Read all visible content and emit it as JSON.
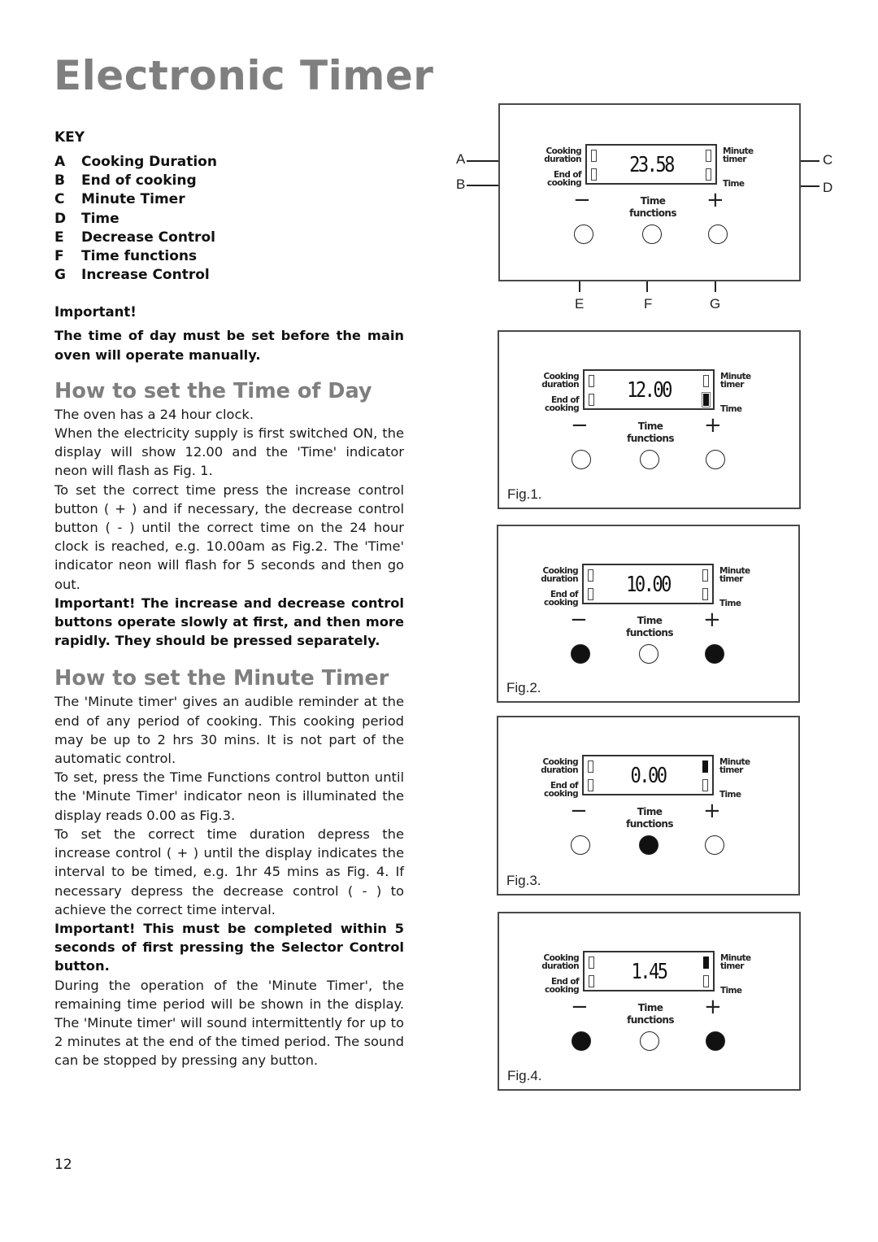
{
  "page": {
    "title": "Electronic Timer",
    "page_number": "12"
  },
  "key": {
    "heading": "KEY",
    "items": [
      {
        "letter": "A",
        "label": "Cooking Duration"
      },
      {
        "letter": "B",
        "label": "End of cooking"
      },
      {
        "letter": "C",
        "label": "Minute Timer"
      },
      {
        "letter": "D",
        "label": "Time"
      },
      {
        "letter": "E",
        "label": "Decrease Control"
      },
      {
        "letter": "F",
        "label": "Time functions"
      },
      {
        "letter": "G",
        "label": "Increase Control"
      }
    ]
  },
  "important_intro": {
    "heading": "Important!",
    "text": "The time of day must be set before the main oven will operate manually."
  },
  "time_of_day": {
    "heading": "How to set the Time of Day",
    "paragraphs": [
      "The oven has a 24 hour clock.",
      "When the electricity supply is first switched ON, the display will show 12.00 and the 'Time' indicator neon will flash as Fig. 1.",
      "To set the correct time press the increase control button ( + ) and if necessary, the decrease control button ( - ) until the correct time on the 24 hour clock is reached, e.g. 10.00am as Fig.2.  The 'Time' indicator neon will flash for 5 seconds and then go out."
    ],
    "important": "Important! The increase and decrease control buttons operate slowly at first, and then more rapidly.  They should be pressed separately."
  },
  "minute_timer": {
    "heading": "How to set the Minute Timer",
    "paragraphs": [
      "The 'Minute timer' gives an audible reminder at the end of any period of cooking.  This cooking period may be up to 2 hrs 30 mins.  It is not part of the automatic control.",
      "To set, press the Time Functions control button until the 'Minute Timer' indicator neon is illuminated the display reads 0.00 as Fig.3.",
      "To set the correct time duration depress the increase control ( + ) until the display indicates the interval to be timed, e.g. 1hr 45 mins as Fig. 4.  If necessary depress the decrease control ( - ) to achieve the correct time interval."
    ],
    "important": "Important!  This must be completed within 5 seconds of first pressing the Selector Control button.",
    "closing": "During the operation of the 'Minute Timer', the remaining time period will be shown in the display. The 'Minute timer' will sound intermittently for up to 2 minutes at the end of the timed period.  The sound can be stopped by pressing any button."
  },
  "panel_labels": {
    "cooking_duration": "Cooking duration",
    "end_of_cooking": "End of cooking",
    "minute_timer": "Minute timer",
    "time": "Time",
    "time_functions": "Time functions",
    "minus": "−",
    "plus": "+"
  },
  "callouts": {
    "A": "A",
    "B": "B",
    "C": "C",
    "D": "D",
    "E": "E",
    "F": "F",
    "G": "G"
  },
  "figures": [
    {
      "id": "main",
      "caption": "",
      "display": "23.58",
      "indicators": {
        "cooking_duration": "off",
        "end_of_cooking": "off",
        "minute_timer": "off",
        "time": "off"
      },
      "buttons": {
        "minus": "released",
        "time_functions": "released",
        "plus": "released"
      }
    },
    {
      "id": "fig1",
      "caption": "Fig.1.",
      "display": "12.00",
      "indicators": {
        "cooking_duration": "off",
        "end_of_cooking": "off",
        "minute_timer": "off",
        "time": "flashing"
      },
      "buttons": {
        "minus": "released",
        "time_functions": "released",
        "plus": "released"
      }
    },
    {
      "id": "fig2",
      "caption": "Fig.2.",
      "display": "10.00",
      "indicators": {
        "cooking_duration": "off",
        "end_of_cooking": "off",
        "minute_timer": "off",
        "time": "off"
      },
      "buttons": {
        "minus": "pressed",
        "time_functions": "released",
        "plus": "pressed"
      }
    },
    {
      "id": "fig3",
      "caption": "Fig.3.",
      "display": "0.00",
      "indicators": {
        "cooking_duration": "off",
        "end_of_cooking": "off",
        "minute_timer": "on",
        "time": "off"
      },
      "buttons": {
        "minus": "released",
        "time_functions": "pressed",
        "plus": "released"
      }
    },
    {
      "id": "fig4",
      "caption": "Fig.4.",
      "display": "1.45",
      "indicators": {
        "cooking_duration": "off",
        "end_of_cooking": "off",
        "minute_timer": "on",
        "time": "off"
      },
      "buttons": {
        "minus": "pressed",
        "time_functions": "released",
        "plus": "pressed"
      }
    }
  ]
}
